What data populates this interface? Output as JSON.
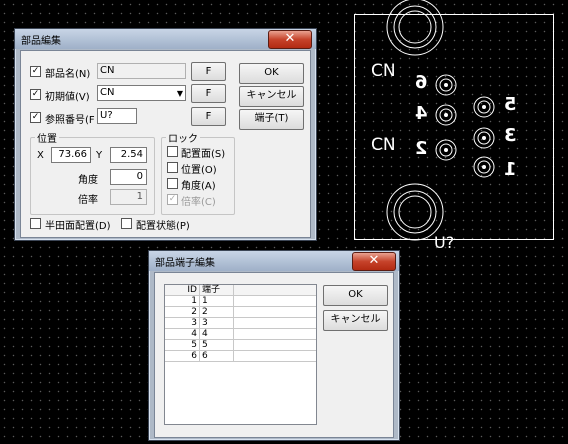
{
  "footprint": {
    "ref": "U?",
    "label_top": "CN",
    "label_bottom": "CN",
    "pin_numbers_left": [
      "6",
      "4",
      "2"
    ],
    "pin_numbers_right": [
      "5",
      "3",
      "1"
    ]
  },
  "part_dialog": {
    "title": "部品編集",
    "close_glyph": "✕",
    "part_name_label": "部品名(N)",
    "part_name_value": "CN",
    "initial_value_label": "初期値(V)",
    "initial_value_value": "CN",
    "ref_label": "参照番号(F",
    "ref_value": "U?",
    "f_button": "F",
    "ok_button": "OK",
    "cancel_button": "キャンセル",
    "pins_button": "端子(T)",
    "position_group": "位置",
    "x_label": "X",
    "x_value": "73.66",
    "y_label": "Y",
    "y_value": "2.54",
    "angle_label": "角度",
    "angle_value": "0",
    "scale_label": "倍率",
    "scale_value": "1",
    "lock_group": "ロック",
    "lock_side": "配置面(S)",
    "lock_position": "位置(O)",
    "lock_angle": "角度(A)",
    "lock_scale": "倍率(C)",
    "half_side": "半田面配置(D)",
    "placement_state": "配置状態(P)",
    "check_mark": "✓"
  },
  "pin_dialog": {
    "title": "部品端子編集",
    "close_glyph": "✕",
    "col_id": "ID",
    "col_pin": "端子",
    "ok_button": "OK",
    "cancel_button": "キャンセル",
    "rows": [
      {
        "id": "1",
        "pin": "1"
      },
      {
        "id": "2",
        "pin": "2"
      },
      {
        "id": "3",
        "pin": "3"
      },
      {
        "id": "4",
        "pin": "4"
      },
      {
        "id": "5",
        "pin": "5"
      },
      {
        "id": "6",
        "pin": "6"
      }
    ]
  }
}
